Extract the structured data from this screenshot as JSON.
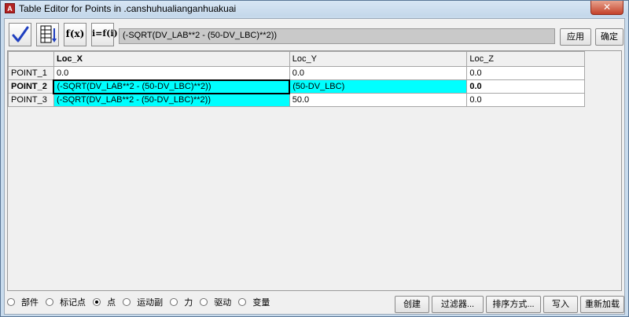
{
  "window": {
    "title": "Table Editor for Points in .canshuhualianganhuakuai",
    "close_glyph": "✕",
    "app_icon_letter": "A"
  },
  "toolbar": {
    "apply_check_icon": "checkmark-icon",
    "f_x_label": "f(x)",
    "i_f_label": "i=f(i)",
    "formula": "(-SQRT(DV_LAB**2 - (50-DV_LBC)**2))",
    "apply_label": "应用",
    "ok_label": "确定"
  },
  "table": {
    "columns": [
      "Loc_X",
      "Loc_Y",
      "Loc_Z"
    ],
    "rows": [
      {
        "name": "POINT_1",
        "cells": [
          "0.0",
          "0.0",
          "0.0"
        ]
      },
      {
        "name": "POINT_2",
        "cells": [
          "(-SQRT(DV_LAB**2 - (50-DV_LBC)**2))",
          "(50-DV_LBC)",
          "0.0"
        ]
      },
      {
        "name": "POINT_3",
        "cells": [
          "(-SQRT(DV_LAB**2 - (50-DV_LBC)**2))",
          "50.0",
          "0.0"
        ]
      }
    ]
  },
  "filter": {
    "options": [
      "部件",
      "标记点",
      "点",
      "运动副",
      "力",
      "驱动",
      "变量"
    ],
    "selected": "点"
  },
  "buttons": {
    "create": "创建",
    "filter": "过滤器...",
    "sort": "排序方式...",
    "write": "写入",
    "reload": "重新加载"
  },
  "colors": {
    "highlight_cell": "#00ffff",
    "title_bar": "#c8dbed",
    "check_blue": "#1f3fbf"
  }
}
